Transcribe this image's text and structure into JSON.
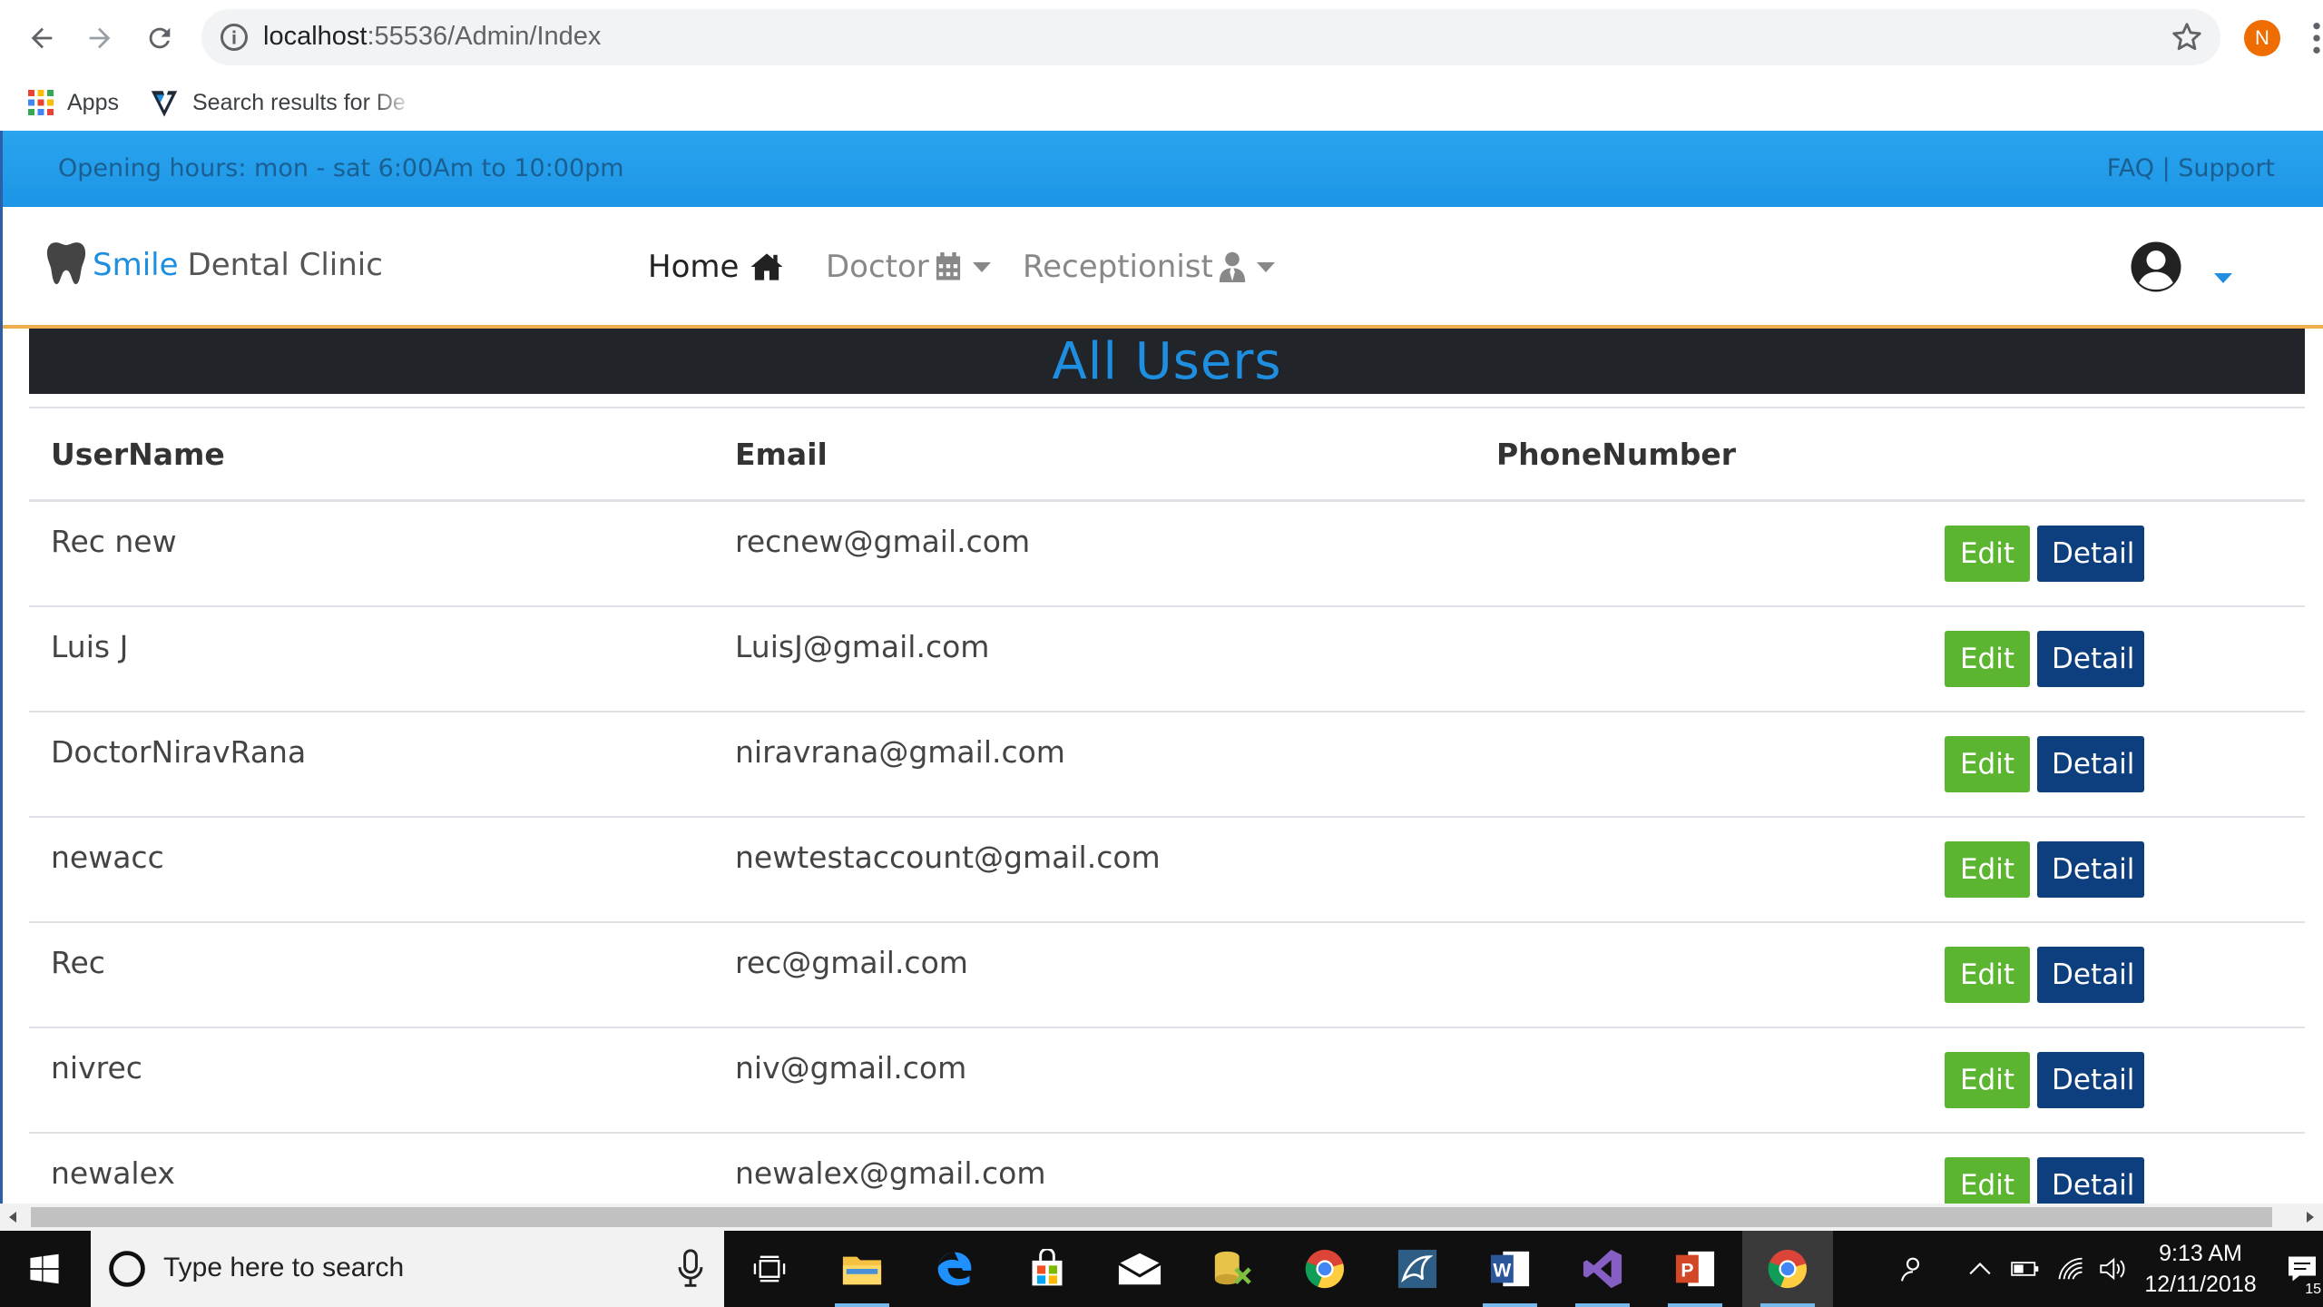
{
  "browser": {
    "url_host": "localhost",
    "url_path": ":55536/Admin/Index",
    "profile_initial": "N",
    "bookmarks": [
      {
        "label": "Apps"
      },
      {
        "label": "Search results for De"
      }
    ]
  },
  "topbar": {
    "hours": "Opening hours: mon - sat 6:00Am to 10:00pm",
    "faq": "FAQ",
    "separator": " | ",
    "support": "Support"
  },
  "brand": {
    "smile": "Smile",
    "clinic": "Dental Clinic"
  },
  "nav": {
    "home": "Home",
    "doctor": "Doctor",
    "receptionist": "Receptionist"
  },
  "page": {
    "title": "All Users"
  },
  "table": {
    "headers": {
      "username": "UserName",
      "email": "Email",
      "phone": "PhoneNumber"
    },
    "edit_label": "Edit",
    "detail_label": "Detail",
    "rows": [
      {
        "username": "Rec new",
        "email": "recnew@gmail.com",
        "phone": ""
      },
      {
        "username": "Luis J",
        "email": "LuisJ@gmail.com",
        "phone": ""
      },
      {
        "username": "DoctorNiravRana",
        "email": "niravrana@gmail.com",
        "phone": ""
      },
      {
        "username": "newacc",
        "email": "newtestaccount@gmail.com",
        "phone": ""
      },
      {
        "username": "Rec",
        "email": "rec@gmail.com",
        "phone": ""
      },
      {
        "username": "nivrec",
        "email": "niv@gmail.com",
        "phone": ""
      },
      {
        "username": "newalex",
        "email": "newalex@gmail.com",
        "phone": ""
      }
    ]
  },
  "taskbar": {
    "search_placeholder": "Type here to search",
    "time": "9:13 AM",
    "date": "12/11/2018",
    "notification_count": "15"
  },
  "colors": {
    "topbar_blue": "#1d95e6",
    "brand_blue": "#1e8fe0",
    "edit_green": "#5cb531",
    "detail_navy": "#0d3f7e",
    "heading_dark": "#212529",
    "nav_underline": "#f0ad4e"
  }
}
